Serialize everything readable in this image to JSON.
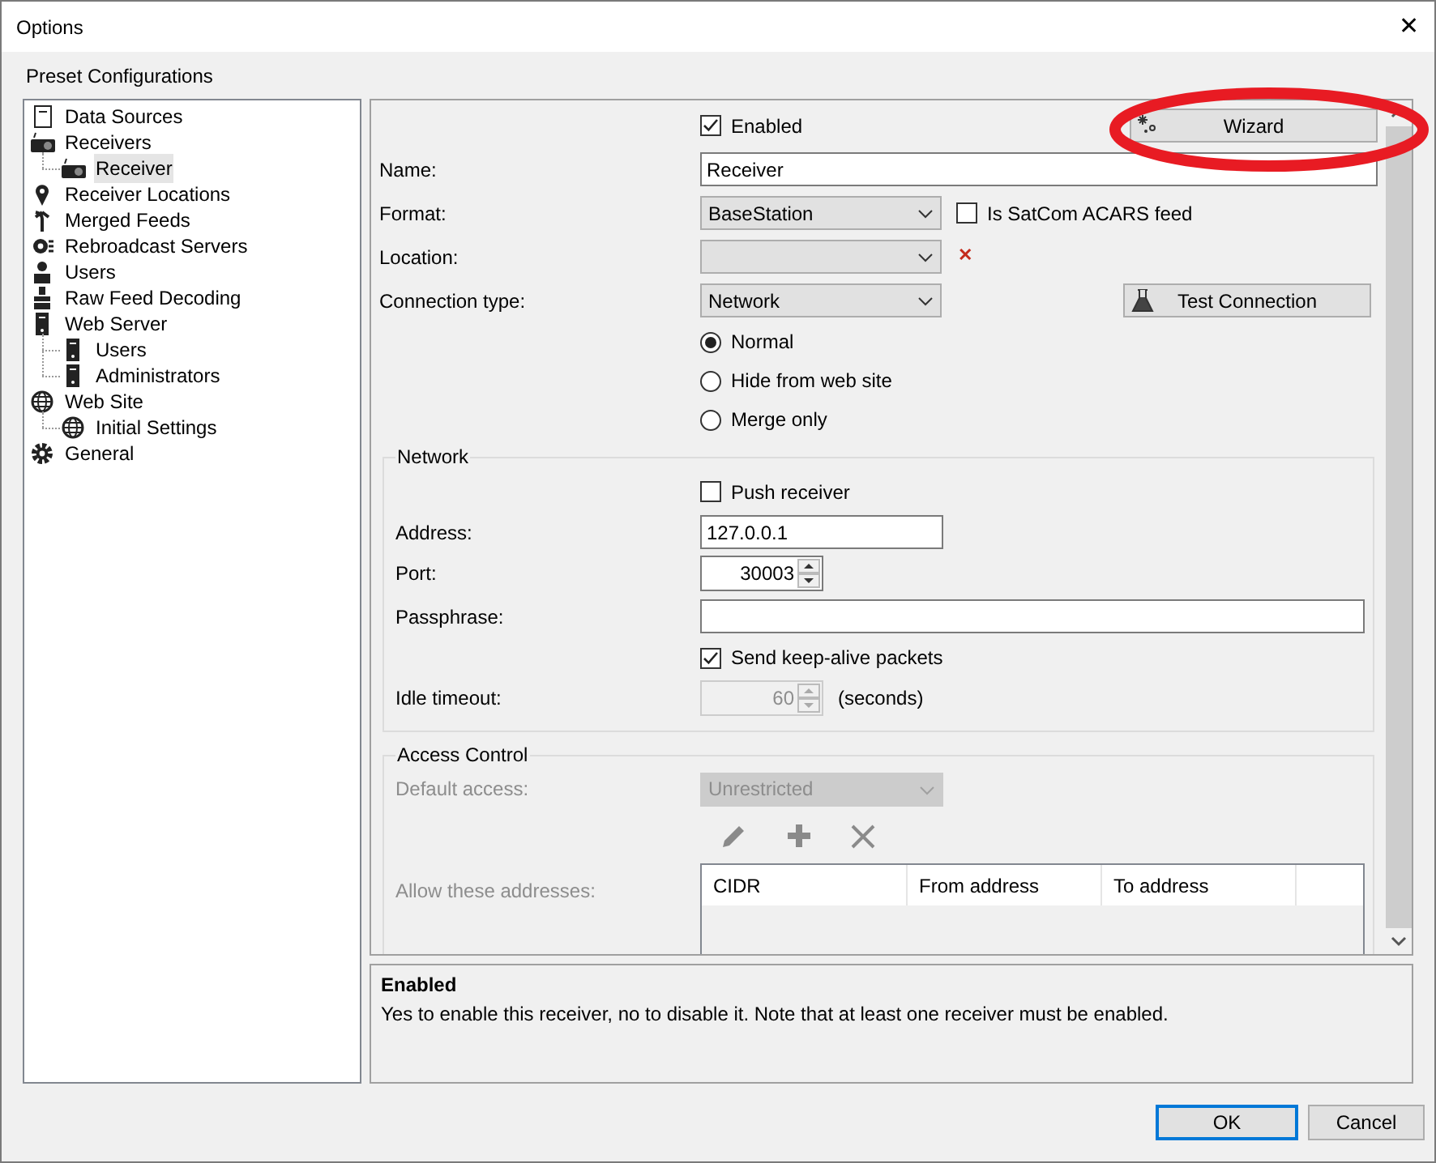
{
  "window": {
    "title": "Options",
    "close": "✕"
  },
  "section_label": "Preset Configurations",
  "tree": [
    {
      "label": "Data Sources",
      "kind": "document",
      "selected": false
    },
    {
      "label": "Receivers",
      "kind": "radio",
      "selected": false,
      "children": [
        {
          "label": "Receiver",
          "kind": "radio",
          "selected": true
        }
      ]
    },
    {
      "label": "Receiver Locations",
      "kind": "pin",
      "selected": false
    },
    {
      "label": "Merged Feeds",
      "kind": "merge",
      "selected": false
    },
    {
      "label": "Rebroadcast Servers",
      "kind": "rebroadcast",
      "selected": false
    },
    {
      "label": "Users",
      "kind": "user",
      "selected": false
    },
    {
      "label": "Raw Feed Decoding",
      "kind": "decoding",
      "selected": false
    },
    {
      "label": "Web Server",
      "kind": "server",
      "selected": false,
      "children": [
        {
          "label": "Users",
          "kind": "server",
          "selected": false
        },
        {
          "label": "Administrators",
          "kind": "server",
          "selected": false
        }
      ]
    },
    {
      "label": "Web Site",
      "kind": "globe",
      "selected": false,
      "children": [
        {
          "label": "Initial Settings",
          "kind": "globe",
          "selected": false
        }
      ]
    },
    {
      "label": "General",
      "kind": "gear",
      "selected": false
    }
  ],
  "form": {
    "enabled": {
      "label": "Enabled",
      "checked": true
    },
    "wizard_button": "Wizard",
    "name": {
      "label": "Name:",
      "value": "Receiver"
    },
    "format": {
      "label": "Format:",
      "value": "BaseStation"
    },
    "satcom": {
      "label": "Is SatCom ACARS feed",
      "checked": false
    },
    "location": {
      "label": "Location:",
      "clear": "✕"
    },
    "connection_type": {
      "label": "Connection type:",
      "value": "Network"
    },
    "test_button": "Test Connection",
    "modes": [
      {
        "label": "Normal",
        "selected": true
      },
      {
        "label": "Hide from web site",
        "selected": false
      },
      {
        "label": "Merge only",
        "selected": false
      }
    ],
    "network": {
      "title": "Network",
      "push_receiver": {
        "label": "Push receiver",
        "checked": false
      },
      "address": {
        "label": "Address:",
        "value": "127.0.0.1"
      },
      "port": {
        "label": "Port:",
        "value": "30003"
      },
      "passphrase": {
        "label": "Passphrase:"
      },
      "keep_alive": {
        "label": "Send keep-alive packets",
        "checked": true
      },
      "idle_timeout": {
        "label": "Idle timeout:",
        "value": "60",
        "unit": "(seconds)",
        "disabled": true
      }
    },
    "access_control": {
      "title": "Access Control",
      "default_access": {
        "label": "Default access:",
        "value": "Unrestricted",
        "disabled": true
      },
      "allow_label": "Allow these addresses:",
      "columns": [
        "CIDR",
        "From address",
        "To address"
      ]
    }
  },
  "description": {
    "title": "Enabled",
    "text": "Yes to enable this receiver, no to disable it. Note that at least one receiver must be enabled."
  },
  "buttons": [
    {
      "label": "OK",
      "default": true
    },
    {
      "label": "Cancel",
      "default": false
    }
  ]
}
